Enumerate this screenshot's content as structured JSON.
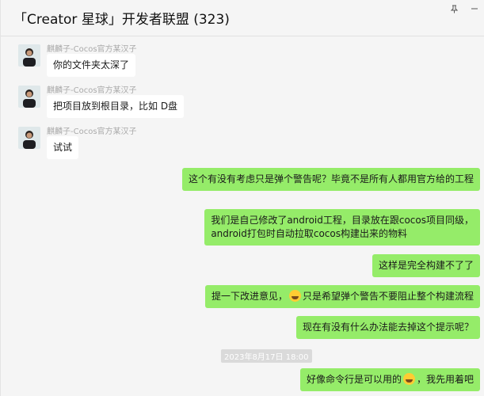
{
  "header": {
    "title": "「Creator 星球」开发者联盟 (323)",
    "controls": {
      "pin": "pin-icon",
      "minimize": "minimize-icon"
    }
  },
  "messages_in": [
    {
      "sender": "麒麟子-Cocos官方某汉子",
      "text": "你的文件夹太深了"
    },
    {
      "sender": "麒麟子-Cocos官方某汉子",
      "text": "把项目放到根目录，比如 D盘"
    },
    {
      "sender": "麒麟子-Cocos官方某汉子",
      "text": "试试"
    }
  ],
  "messages_out": [
    {
      "text": "这个有没有考虑只是弹个警告呢？毕竟不是所有人都用官方给的工程"
    },
    {
      "line1": "我们是自己修改了android工程，目录放在跟cocos项目同级，",
      "line2": "android打包时自动拉取cocos构建出来的物料"
    },
    {
      "text": "这样是完全构建不了了"
    },
    {
      "before": "提一下改进意见，",
      "after": "只是希望弹个警告不要阻止整个构建流程"
    },
    {
      "text": "现在有没有什么办法能去掉这个提示呢？"
    },
    {
      "before": "好像命令行是可以用的",
      "after": "，我先用着吧"
    }
  ],
  "timestamp": "2023年8月17日 18:00",
  "colors": {
    "bubble_out": "#95ec69",
    "bubble_in": "#ffffff",
    "background": "#f5f5f5"
  }
}
